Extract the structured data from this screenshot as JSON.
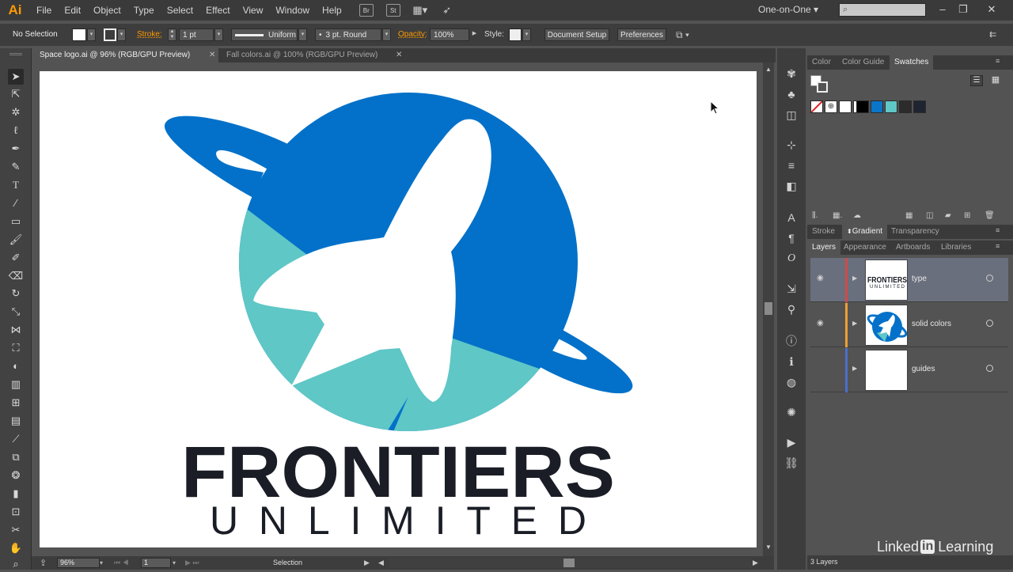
{
  "app": {
    "logo": "Ai"
  },
  "menu": [
    "File",
    "Edit",
    "Object",
    "Type",
    "Select",
    "Effect",
    "View",
    "Window",
    "Help"
  ],
  "menu_icons": [
    "Br",
    "St"
  ],
  "workspace": "One-on-One",
  "window_controls": {
    "minimize": "–",
    "restore": "❐",
    "close": "✕"
  },
  "control": {
    "selection": "No Selection",
    "stroke_label": "Stroke:",
    "stroke_weight": "1 pt",
    "stroke_profile": "Uniform",
    "brush": "3 pt. Round",
    "opacity_label": "Opacity:",
    "opacity": "100%",
    "style_label": "Style:",
    "document_setup": "Document Setup",
    "preferences": "Preferences"
  },
  "tabs": [
    {
      "label": "Space logo.ai @ 96% (RGB/GPU Preview)"
    },
    {
      "label": "Fall colors.ai @ 100% (RGB/GPU Preview)"
    }
  ],
  "artwork": {
    "title": "FRONTIERS",
    "subtitle": "UNLIMITED",
    "colors": {
      "planet": "#0371c9",
      "teal": "#5fc7c6",
      "text": "#1a1d26"
    }
  },
  "status": {
    "zoom": "96%",
    "artboard": "1",
    "tool": "Selection"
  },
  "panels": {
    "top_tabs": [
      "Color",
      "Color Guide",
      "Swatches"
    ],
    "mid_tabs": [
      "Stroke",
      "Gradient",
      "Transparency"
    ],
    "layer_tabs": [
      "Layers",
      "Appearance",
      "Artboards",
      "Libraries"
    ],
    "swatch_colors": [
      "#ffffff",
      "#ffffff",
      "#000000",
      "#0a75c9",
      "#5fc7c6",
      "#2b2b2b",
      "#1e2430"
    ],
    "layers": [
      {
        "name": "type",
        "color": "#d04a4a"
      },
      {
        "name": "solid colors",
        "color": "#f0a030"
      },
      {
        "name": "guides",
        "color": "#4a6fd0"
      }
    ],
    "layer_count": "3 Layers"
  },
  "watermark": {
    "brand": "Linked",
    "in": "in",
    "product": "Learning"
  }
}
